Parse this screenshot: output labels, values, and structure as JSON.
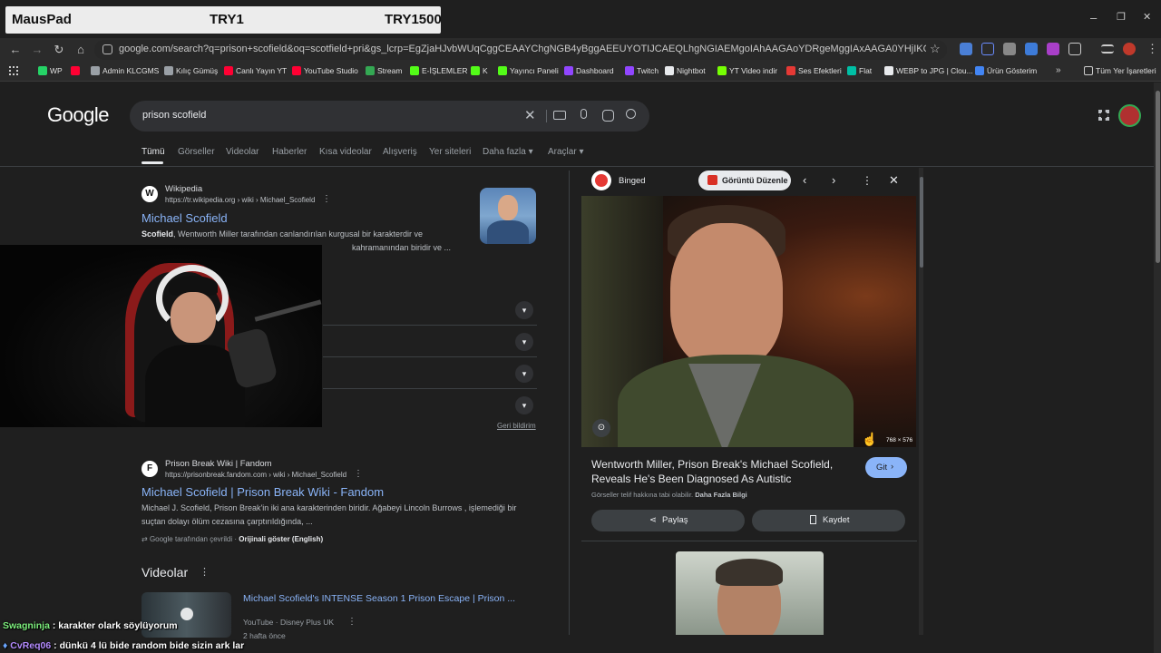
{
  "overlay": {
    "left": "MausPad",
    "mid": "TRY1",
    "right": "TRY1500"
  },
  "window": {
    "minimize": "–",
    "maximize": "❐",
    "close": "✕"
  },
  "omnibox": {
    "url": "google.com/search?q=prison+scofield&oq=scotfield+pri&gs_lcrp=EgZjaHJvbWUqCggCEAAYChgNGB4yBggAEEUYOTIJCAEQLhgNGIAEMgoIAhAAGAoYDRgeMggIAxAAGA0YHjIKCAQQABgKGA0YHjIICAUQABgNGB4..."
  },
  "bookmarks": [
    {
      "label": "WP",
      "color": "#25d366"
    },
    {
      "label": "",
      "color": "#ff0033"
    },
    {
      "label": "Admin KLCGMS",
      "color": "#9aa0a6"
    },
    {
      "label": "Kılıç Gümüş",
      "color": "#9aa0a6"
    },
    {
      "label": "Canlı Yayın YT",
      "color": "#ff0033"
    },
    {
      "label": "YouTube Studio",
      "color": "#ff0033"
    },
    {
      "label": "Stream",
      "color": "#34a853"
    },
    {
      "label": "E-İŞLEMLER",
      "color": "#53fc18"
    },
    {
      "label": "K",
      "color": "#53fc18"
    },
    {
      "label": "Yayıncı Paneli",
      "color": "#53fc18"
    },
    {
      "label": "Dashboard",
      "color": "#9146ff"
    },
    {
      "label": "Twitch",
      "color": "#9146ff"
    },
    {
      "label": "Nightbot",
      "color": "#e8eaed"
    },
    {
      "label": "YT Video indir",
      "color": "#76ff03"
    },
    {
      "label": "Ses Efektleri",
      "color": "#e53935"
    },
    {
      "label": "Flat",
      "color": "#00bfa5"
    },
    {
      "label": "WEBP to JPG | Clou...",
      "color": "#e8eaed"
    },
    {
      "label": "Ürün Gösterim",
      "color": "#4285f4"
    }
  ],
  "bookmarks_more": "»",
  "bookmarks_folder": "Tüm Yer İşaretleri",
  "search": {
    "logo": "Google",
    "query": "prison scofield"
  },
  "tabs": [
    "Tümü",
    "Görseller",
    "Videolar",
    "Haberler",
    "Kısa videolar",
    "Alışveriş",
    "Yer siteleri",
    "Daha fazla",
    "Araçlar"
  ],
  "result1": {
    "site": "Wikipedia",
    "url": "https://tr.wikipedia.org › wiki › Michael_Scofield",
    "title": "Michael Scofield",
    "snippet_bold": "Scofield",
    "snippet": ", Wentworth Miller tarafından canlandırılan kurgusal bir karakterdir ve",
    "snippet2": "kahramanından biridir ve ..."
  },
  "feedback": "Geri bildirim",
  "result2": {
    "site": "Prison Break Wiki | Fandom",
    "url": "https://prisonbreak.fandom.com › wiki › Michael_Scofield",
    "title": "Michael Scofield | Prison Break Wiki - Fandom",
    "snippet": "Michael J. Scofield, Prison Break'in iki ana karakterinden biridir. Ağabeyi Lincoln Burrows , işlemediği bir suçtan dolayı ölüm cezasına çarptırıldığında, ...",
    "translated": "Google tarafından çevrildi",
    "original": "Orijinali göster (English)"
  },
  "videos": {
    "heading": "Videolar",
    "title": "Michael Scofield's INTENSE Season 1 Prison Escape | Prison ...",
    "source": "YouTube · Disney Plus UK",
    "age": "2 hafta önce"
  },
  "panel": {
    "source": "Binged",
    "edit": "Görüntü Düzenle",
    "dimensions": "768 × 576",
    "title": "Wentworth Miller, Prison Break's Michael Scofield, Reveals He's Been Diagnosed As Autistic",
    "go": "Git",
    "copyright": "Görseller telif hakkına tabi olabilir.",
    "more": "Daha Fazla Bilgi",
    "share": "Paylaş",
    "save": "Kaydet"
  },
  "chat": [
    {
      "user": "Swagninja",
      "msg": " : karakter olark söylüyorum"
    },
    {
      "user": "CvReq06",
      "msg": " : dünkü 4 lü bide random bide sizin ark lar"
    }
  ]
}
